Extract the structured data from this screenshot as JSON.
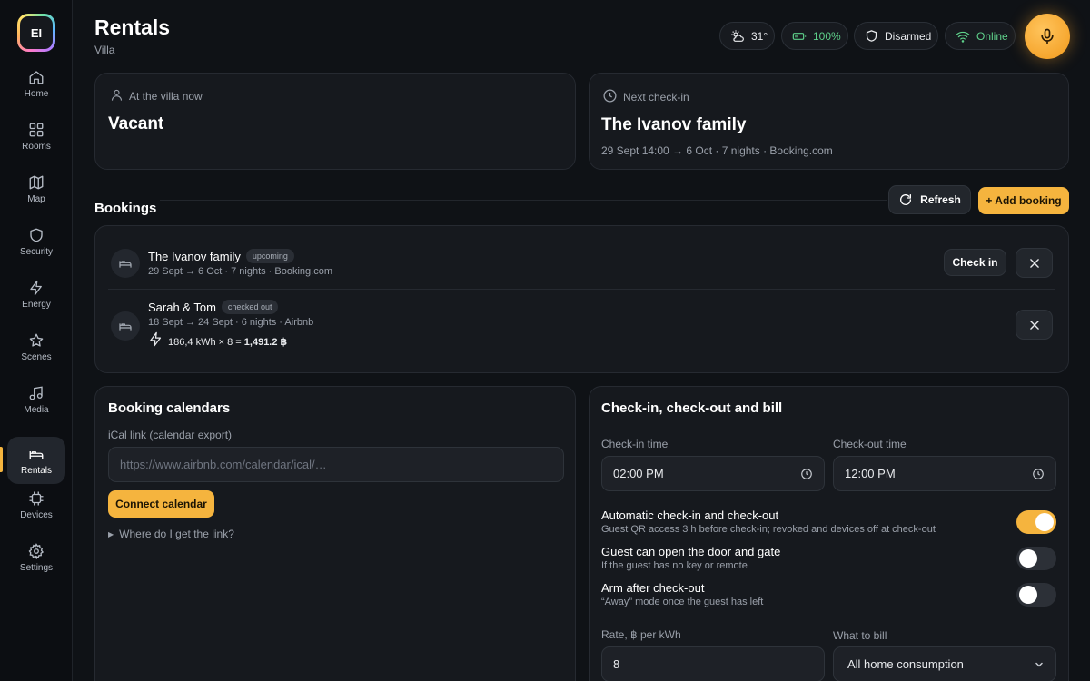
{
  "sidebar": {
    "logo_text": "EI",
    "items": [
      {
        "label": "Home",
        "icon": "home-icon"
      },
      {
        "label": "Rooms",
        "icon": "grid-icon"
      },
      {
        "label": "Map",
        "icon": "map-icon"
      },
      {
        "label": "Security",
        "icon": "shield-icon"
      },
      {
        "label": "Energy",
        "icon": "bolt-icon"
      },
      {
        "label": "Scenes",
        "icon": "star-icon"
      },
      {
        "label": "Media",
        "icon": "music-icon"
      },
      {
        "label": "Rentals",
        "icon": "bed-icon"
      },
      {
        "label": "Devices",
        "icon": "chip-icon"
      },
      {
        "label": "Settings",
        "icon": "gear-icon"
      }
    ],
    "active_index": 7
  },
  "header": {
    "title": "Rentals",
    "subtitle": "Villa",
    "weather": "31°",
    "battery": "100%",
    "security": "Disarmed",
    "network": "Online"
  },
  "status_cards": {
    "now": {
      "label": "At the villa now",
      "value": "Vacant"
    },
    "next": {
      "label": "Next check-in",
      "value": "The Ivanov family",
      "meta": "29 Sept 14:00 → 6 Oct · 7 nights · Booking.com"
    }
  },
  "bookings": {
    "title": "Bookings",
    "refresh_label": "Refresh",
    "add_label": "+ Add booking",
    "items": [
      {
        "name": "The Ivanov family",
        "badge": "upcoming",
        "meta": "29 Sept → 6 Oct · 7 nights · Booking.com",
        "action": "Check in"
      },
      {
        "name": "Sarah & Tom",
        "badge": "checked out",
        "meta": "18 Sept → 24 Sept · 6 nights · Airbnb",
        "energy_text": "186,4 kWh × 8 = ",
        "energy_total": "1,491.2 ฿"
      }
    ]
  },
  "calendars": {
    "title": "Booking calendars",
    "ical_label": "iCal link (calendar export)",
    "ical_placeholder": "https://www.airbnb.com/calendar/ical/…",
    "connect_label": "Connect calendar",
    "help_label": "Where do I get the link?"
  },
  "checkin": {
    "title": "Check-in, check-out and bill",
    "checkin_label": "Check-in time",
    "checkin_value": "02:00 PM",
    "checkout_label": "Check-out time",
    "checkout_value": "12:00 PM",
    "options": [
      {
        "title": "Automatic check-in and check-out",
        "desc": "Guest QR access 3 h before check-in; revoked and devices off at check-out",
        "on": true
      },
      {
        "title": "Guest can open the door and gate",
        "desc": "If the guest has no key or remote",
        "on": false
      },
      {
        "title": "Arm after check-out",
        "desc": "“Away” mode once the guest has left",
        "on": false
      }
    ],
    "rate_label": "Rate, ฿ per kWh",
    "rate_value": "8",
    "bill_label": "What to bill",
    "bill_value": "All home consumption"
  },
  "colors": {
    "accent": "#f5b43e",
    "online": "#5ed08a",
    "background": "#0f1216",
    "card": "#16191e"
  }
}
